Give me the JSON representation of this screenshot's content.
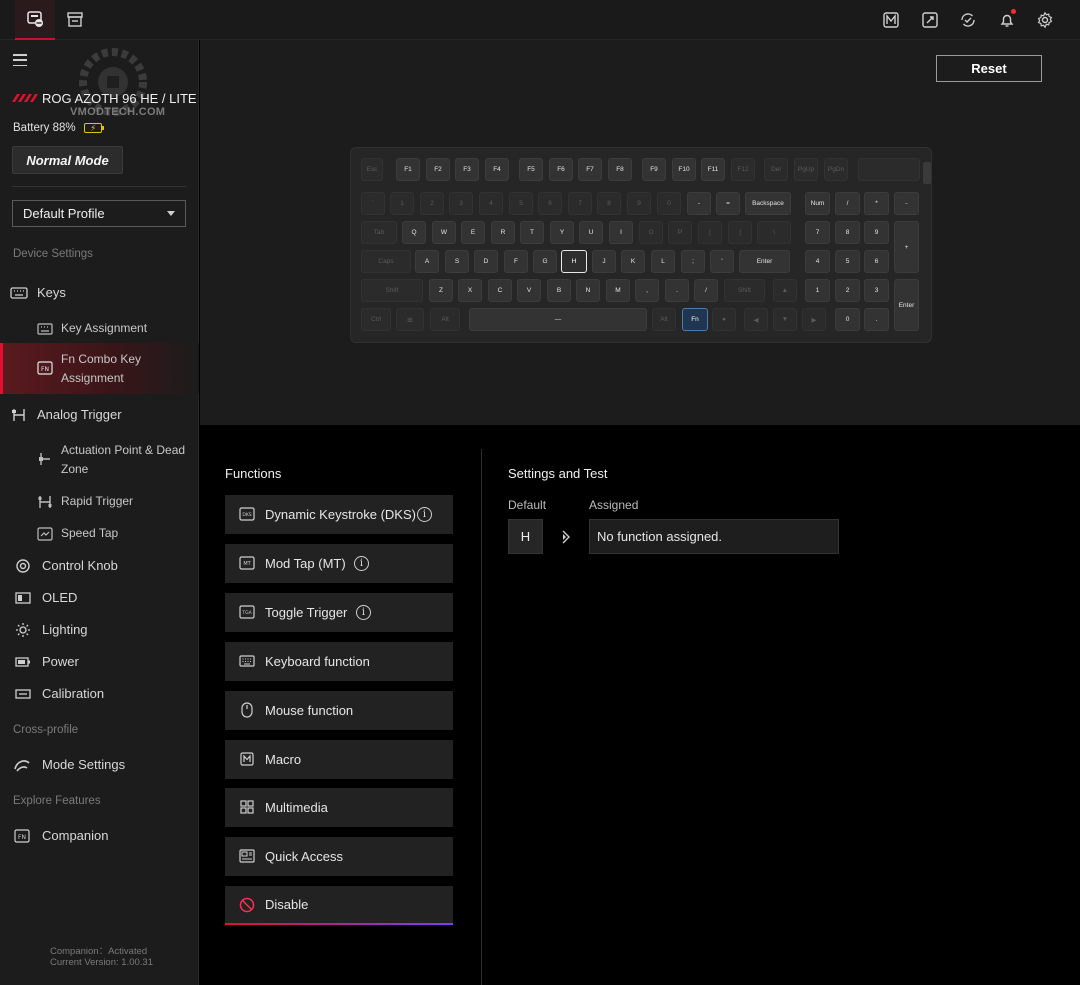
{
  "sidebar": {
    "watermark": "VMODTECH.COM",
    "device_name": "ROG AZOTH 96 HE / LITE",
    "battery": "Battery 88%",
    "mode": "Normal Mode",
    "profile": "Default Profile",
    "section_device": "Device Settings",
    "section_cross": "Cross-profile",
    "section_explore": "Explore Features",
    "items": {
      "keys": "Keys",
      "key_assignment": "Key Assignment",
      "fn_combo_1": "Fn Combo Key",
      "fn_combo_2": "Assignment",
      "analog_trigger": "Analog Trigger",
      "actuation_1": "Actuation Point & Dead",
      "actuation_2": "Zone",
      "rapid_trigger": "Rapid Trigger",
      "speed_tap": "Speed Tap",
      "control_knob": "Control Knob",
      "oled": "OLED",
      "lighting": "Lighting",
      "power": "Power",
      "calibration": "Calibration",
      "mode_settings": "Mode Settings",
      "companion": "Companion"
    },
    "footer_status": "Companion：Activated",
    "footer_version": "Current Version: 1.00.31"
  },
  "toolbar": {
    "reset": "Reset"
  },
  "keyboard": {
    "rows": [
      [
        [
          "Esc",
          1
        ],
        [
          "F1",
          0
        ],
        [
          "F2",
          0
        ],
        [
          "F3",
          0
        ],
        [
          "F4",
          0
        ],
        [
          "F5",
          0
        ],
        [
          "F6",
          0
        ],
        [
          "F7",
          0
        ],
        [
          "F8",
          0
        ],
        [
          "F9",
          0
        ],
        [
          "F10",
          0
        ],
        [
          "F11",
          0
        ],
        [
          "F12",
          1
        ],
        [
          "Del",
          1
        ],
        [
          "PgUp",
          1
        ],
        [
          "PgDn",
          1
        ],
        [
          "",
          1
        ]
      ],
      [
        [
          "`",
          1
        ],
        [
          "1",
          1
        ],
        [
          "2",
          1
        ],
        [
          "3",
          1
        ],
        [
          "4",
          1
        ],
        [
          "5",
          1
        ],
        [
          "6",
          1
        ],
        [
          "7",
          1
        ],
        [
          "8",
          1
        ],
        [
          "9",
          1
        ],
        [
          "0",
          1
        ],
        [
          "-",
          0
        ],
        [
          "=",
          0
        ],
        [
          "Backspace",
          0
        ],
        [
          "Num",
          0
        ],
        [
          "/",
          0
        ],
        [
          "*",
          0
        ],
        [
          "-",
          0
        ]
      ],
      [
        [
          "Tab",
          1
        ],
        [
          "Q",
          0
        ],
        [
          "W",
          0
        ],
        [
          "E",
          0
        ],
        [
          "R",
          0
        ],
        [
          "T",
          0
        ],
        [
          "Y",
          0
        ],
        [
          "U",
          0
        ],
        [
          "I",
          0
        ],
        [
          "O",
          1
        ],
        [
          "P",
          1
        ],
        [
          "[",
          1
        ],
        [
          "]",
          1
        ],
        [
          "\\",
          1
        ],
        [
          "7",
          0
        ],
        [
          "8",
          0
        ],
        [
          "9",
          0
        ],
        [
          "+",
          0
        ]
      ],
      [
        [
          "Caps",
          1
        ],
        [
          "A",
          0
        ],
        [
          "S",
          0
        ],
        [
          "D",
          0
        ],
        [
          "F",
          0
        ],
        [
          "G",
          0
        ],
        [
          "H",
          2
        ],
        [
          "J",
          0
        ],
        [
          "K",
          0
        ],
        [
          "L",
          0
        ],
        [
          ";",
          0
        ],
        [
          "'",
          0
        ],
        [
          "Enter",
          0
        ],
        [
          "4",
          0
        ],
        [
          "5",
          0
        ],
        [
          "6",
          0
        ]
      ],
      [
        [
          "Shift",
          1
        ],
        [
          "Z",
          0
        ],
        [
          "X",
          0
        ],
        [
          "C",
          0
        ],
        [
          "V",
          0
        ],
        [
          "B",
          0
        ],
        [
          "N",
          0
        ],
        [
          "M",
          0
        ],
        [
          ",",
          0
        ],
        [
          ".",
          0
        ],
        [
          "/",
          0
        ],
        [
          "Shift",
          1
        ],
        [
          "▲",
          1
        ],
        [
          "1",
          0
        ],
        [
          "2",
          0
        ],
        [
          "3",
          0
        ],
        [
          "Enter",
          0
        ]
      ],
      [
        [
          "Ctrl",
          1
        ],
        [
          "⊞",
          1
        ],
        [
          "Alt",
          1
        ],
        [
          "—",
          0
        ],
        [
          "Alt",
          1
        ],
        [
          "Fn",
          3
        ],
        [
          "●",
          1
        ],
        [
          "◀",
          1
        ],
        [
          "▼",
          1
        ],
        [
          "▶",
          1
        ],
        [
          "0",
          0
        ],
        [
          ".",
          0
        ]
      ]
    ]
  },
  "functions": {
    "title": "Functions",
    "items": [
      {
        "label": "Dynamic Keystroke (DKS)",
        "icon": "dks-icon",
        "info": true
      },
      {
        "label": "Mod Tap (MT)",
        "icon": "mt-icon",
        "info": true
      },
      {
        "label": "Toggle Trigger",
        "icon": "tga-icon",
        "info": true
      },
      {
        "label": "Keyboard function",
        "icon": "keyboard-icon",
        "info": false
      },
      {
        "label": "Mouse function",
        "icon": "mouse-icon",
        "info": false
      },
      {
        "label": "Macro",
        "icon": "macro-icon",
        "info": false
      },
      {
        "label": "Multimedia",
        "icon": "multimedia-icon",
        "info": false
      },
      {
        "label": "Quick Access",
        "icon": "quick-access-icon",
        "info": false
      },
      {
        "label": "Disable",
        "icon": "disable-icon",
        "info": false
      }
    ]
  },
  "settings": {
    "title": "Settings and Test",
    "default_label": "Default",
    "assigned_label": "Assigned",
    "default_key": "H",
    "assigned_value": "No function assigned."
  },
  "colors": {
    "accent": "#e0102e",
    "fn_key": "#4a7ab8",
    "disable": "#ff2d55"
  }
}
